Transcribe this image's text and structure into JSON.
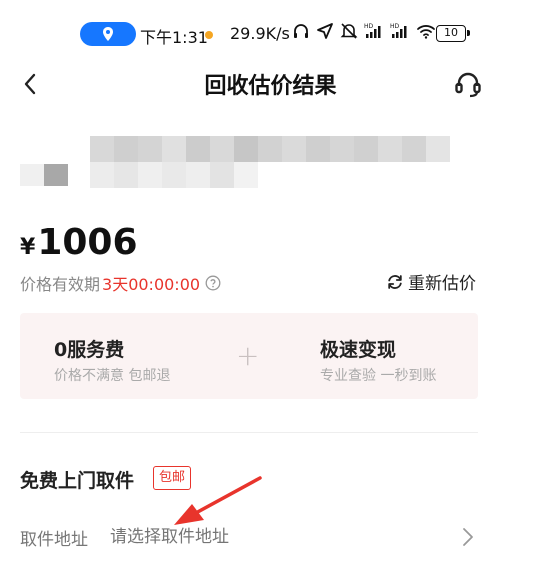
{
  "status_bar": {
    "time": "下午1:31",
    "net_speed": "29.9K/s",
    "battery": "10",
    "icons": [
      "location-icon",
      "headset-status-icon",
      "navigation-icon",
      "mute-icon",
      "signal-hd-icon",
      "signal-hd-icon",
      "wifi-icon",
      "battery-icon"
    ]
  },
  "header": {
    "title": "回收估价结果",
    "back_icon": "chevron-left-icon",
    "service_icon": "headset-icon"
  },
  "price": {
    "currency": "¥",
    "amount": "1006",
    "validity_label": "价格有效期",
    "countdown": "3天00:00:00",
    "reassess_label": "重新估价"
  },
  "services": [
    {
      "title": "0服务费",
      "subtitle": "价格不满意 包邮退"
    },
    {
      "title": "极速变现",
      "subtitle": "专业查验 一秒到账"
    }
  ],
  "services_connector": "+",
  "pickup": {
    "title": "免费上门取件",
    "badge": "包邮",
    "address_label": "取件地址",
    "address_placeholder": "请选择取件地址"
  },
  "colors": {
    "accent_red": "#e8342c",
    "location_blue": "#1677ff",
    "card_bg": "#fbf3f3"
  }
}
